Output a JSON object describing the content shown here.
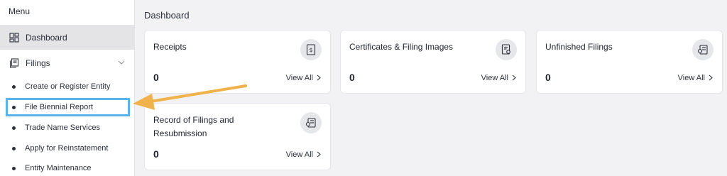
{
  "sidebar": {
    "menu_title": "Menu",
    "dashboard_label": "Dashboard",
    "filings_label": "Filings",
    "items": [
      {
        "label": "Create or Register Entity"
      },
      {
        "label": "File Biennial Report"
      },
      {
        "label": "Trade Name Services"
      },
      {
        "label": "Apply for Reinstatement"
      },
      {
        "label": "Entity Maintenance"
      }
    ]
  },
  "main": {
    "title": "Dashboard",
    "cards": [
      {
        "title": "Receipts",
        "count": "0",
        "view_all": "View All",
        "icon": "receipt-icon"
      },
      {
        "title": "Certificates & Filing Images",
        "count": "0",
        "view_all": "View All",
        "icon": "certificate-icon"
      },
      {
        "title": "Unfinished Filings",
        "count": "0",
        "view_all": "View All",
        "icon": "document-icon"
      },
      {
        "title": "Record of Filings and Resubmission",
        "count": "0",
        "view_all": "View All",
        "icon": "document-icon"
      }
    ]
  },
  "colors": {
    "highlight_box": "#5ab2ea",
    "arrow": "#f0b24a",
    "active_bg": "#e4e4e7",
    "page_bg": "#f2f2f4"
  }
}
